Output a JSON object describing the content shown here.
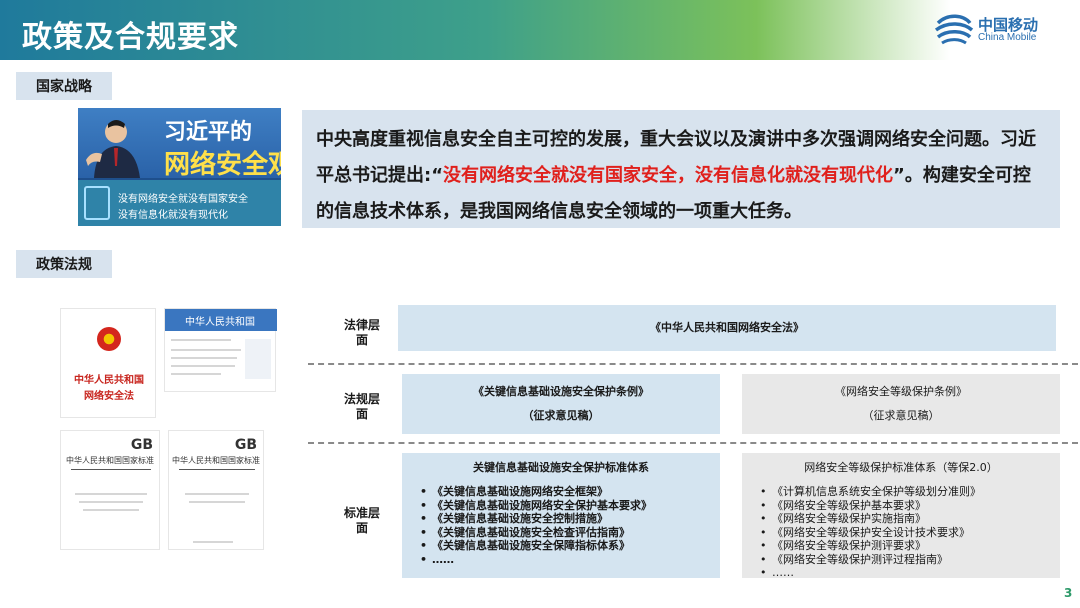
{
  "header": {
    "title": "政策及合规要求",
    "logo_cn": "中国移动",
    "logo_en": "China Mobile"
  },
  "sections": {
    "strategy_label": "国家战略",
    "policy_label": "政策法规"
  },
  "banner": {
    "title_line1": "习近平的",
    "title_line2": "网络安全观",
    "quote_line1": "没有网络安全就没有国家安全",
    "quote_line2": "没有信息化就没有现代化"
  },
  "statement": {
    "part1": "中央高度重视信息安全自主可控的发展，重大会议以及演讲中多次强调网络安全问题。习近平总书记提出:“",
    "highlight": "没有网络安全就没有国家安全，没有信息化就没有现代化",
    "part2": "”。构建安全可控的信息技术体系，是我国网络信息安全领域的一项重大任务。"
  },
  "documents": {
    "law_title_line1": "中华人民共和国",
    "law_title_line2": "网络安全法",
    "web_header": "中华人民共和国",
    "gb_logo": "GB",
    "gb_org1": "中华人民共和国国家标准",
    "gb_org2": "中华人民共和国国家标准"
  },
  "levels": {
    "law": {
      "label": "法律层面",
      "item": "《中华人民共和国网络安全法》"
    },
    "regulation": {
      "label": "法规层面",
      "left_line1": "《关键信息基础设施安全保护条例》",
      "left_line2": "（征求意见稿）",
      "right_line1": "《网络安全等级保护条例》",
      "right_line2": "（征求意见稿）"
    },
    "standard": {
      "label": "标准层面",
      "left_title": "关键信息基础设施安全保护标准体系",
      "left_items": [
        "《关键信息基础设施网络安全框架》",
        "《关键信息基础设施网络安全保护基本要求》",
        "《关键信息基础设施安全控制措施》",
        "《关键信息基础设施安全检查评估指南》",
        "《关键信息基础设施安全保障指标体系》",
        "……"
      ],
      "right_title": "网络安全等级保护标准体系（等保2.0）",
      "right_items": [
        "《计算机信息系统安全保护等级划分准则》",
        "《网络安全等级保护基本要求》",
        "《网络安全等级保护实施指南》",
        "《网络安全等级保护安全设计技术要求》",
        "《网络安全等级保护测评要求》",
        "《网络安全等级保护测评过程指南》",
        "……"
      ]
    }
  },
  "footer": {
    "page_number": "3"
  },
  "colors": {
    "header_start": "#1f7a9c",
    "header_mid": "#7cc15a",
    "highlight_red": "#e0201c",
    "panel_bg": "#d8e3ee",
    "level_blue": "#d4e4f0",
    "level_gray": "#e8e8e8"
  }
}
